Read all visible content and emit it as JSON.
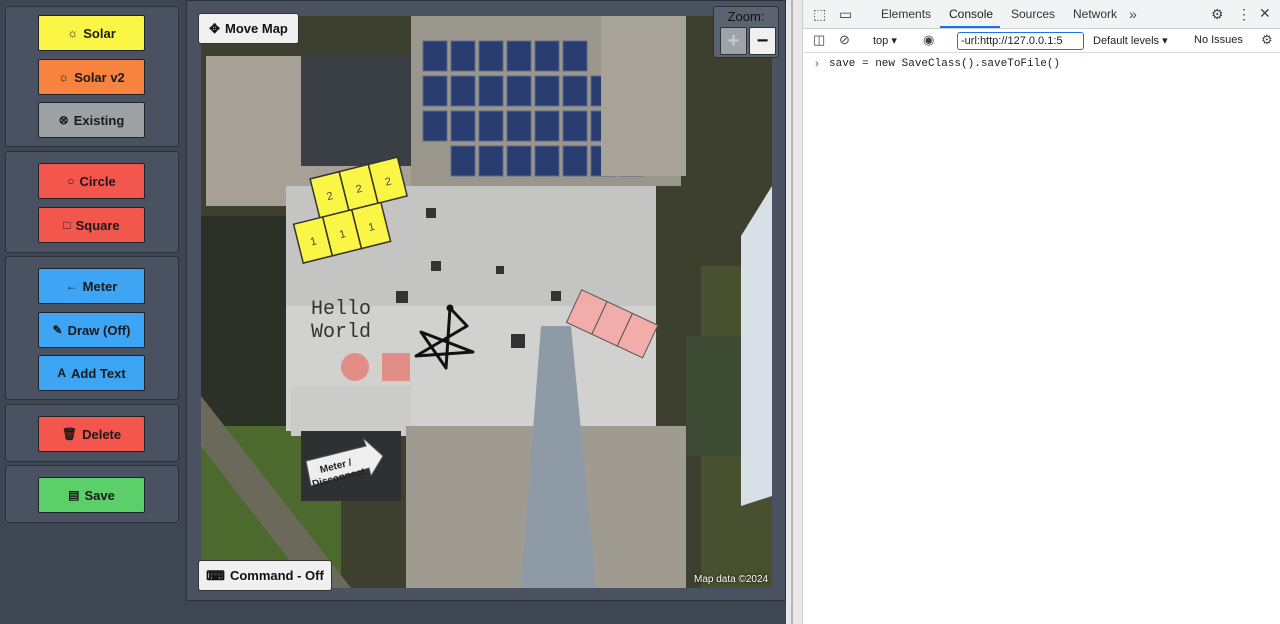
{
  "toolbar": {
    "solar": "Solar",
    "solar_v2": "Solar v2",
    "existing": "Existing",
    "circle": "Circle",
    "square": "Square",
    "meter": "Meter",
    "draw": "Draw (Off)",
    "add_text": "Add Text",
    "delete": "Delete",
    "save": "Save"
  },
  "map": {
    "move_map": "Move Map",
    "zoom_label": "Zoom:",
    "zoom_in": "+",
    "zoom_out": "−",
    "command": "Command - Off",
    "attribution": "Map data ©2024",
    "text_annotation_line1": "Hello",
    "text_annotation_line2": "World",
    "meter_label_line1": "Meter /",
    "meter_label_line2": "Disconnect",
    "panel_labels_top": [
      "2",
      "2",
      "2"
    ],
    "panel_labels_bottom": [
      "1",
      "1",
      "1"
    ]
  },
  "devtools": {
    "tabs": [
      "Elements",
      "Console",
      "Sources",
      "Network"
    ],
    "active_tab": "Console",
    "context": "top",
    "filter_value": "-url:http://127.0.0.1:5",
    "levels": "Default levels",
    "issues": "No Issues",
    "console_line": "save = new SaveClass().saveToFile()"
  },
  "colors": {
    "solar": "#fbf546",
    "solar_v2": "#f7833e",
    "existing": "#9ea1a3",
    "shape": "#f3564d",
    "meter": "#3ea5f5",
    "save": "#5bd06a",
    "console_accent": "#1a73e8"
  }
}
